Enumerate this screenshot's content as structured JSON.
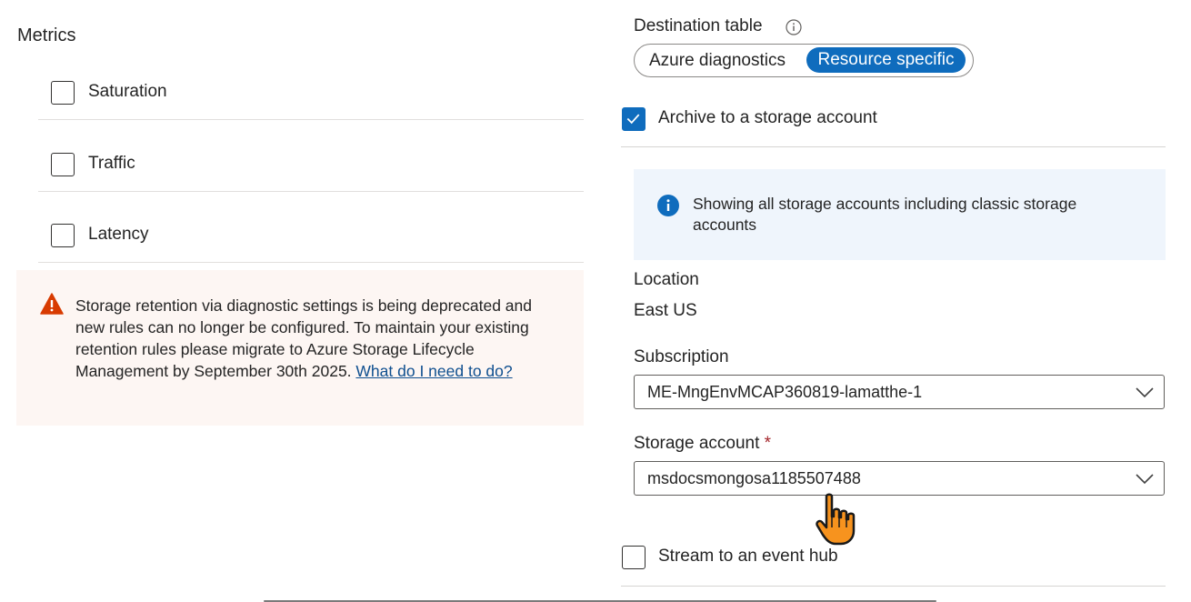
{
  "metrics": {
    "title": "Metrics",
    "items": [
      {
        "label": "Saturation",
        "checked": false
      },
      {
        "label": "Traffic",
        "checked": false
      },
      {
        "label": "Latency",
        "checked": false
      }
    ]
  },
  "warning": {
    "text": "Storage retention via diagnostic settings is being deprecated and new rules can no longer be configured. To maintain your existing retention rules please migrate to Azure Storage Lifecycle Management by September 30th 2025. ",
    "link_text": "What do I need to do?"
  },
  "destination": {
    "label": "Destination table",
    "options": [
      "Azure diagnostics",
      "Resource specific"
    ],
    "selected": "Resource specific"
  },
  "archive": {
    "label": "Archive to a storage account",
    "checked": true
  },
  "info": {
    "text": "Showing all storage accounts including classic storage accounts"
  },
  "location": {
    "label": "Location",
    "value": "East US"
  },
  "subscription": {
    "label": "Subscription",
    "value": "ME-MngEnvMCAP360819-lamatthe-1"
  },
  "storage_account": {
    "label": "Storage account",
    "required_marker": "*",
    "value": "msdocsmongosa1185507488"
  },
  "stream": {
    "label": "Stream to an event hub",
    "checked": false
  },
  "colors": {
    "accent": "#0f6cbd",
    "warning": "#d83b01",
    "warning_bg": "#fdf6f3",
    "info_bg": "#eff5fc"
  }
}
